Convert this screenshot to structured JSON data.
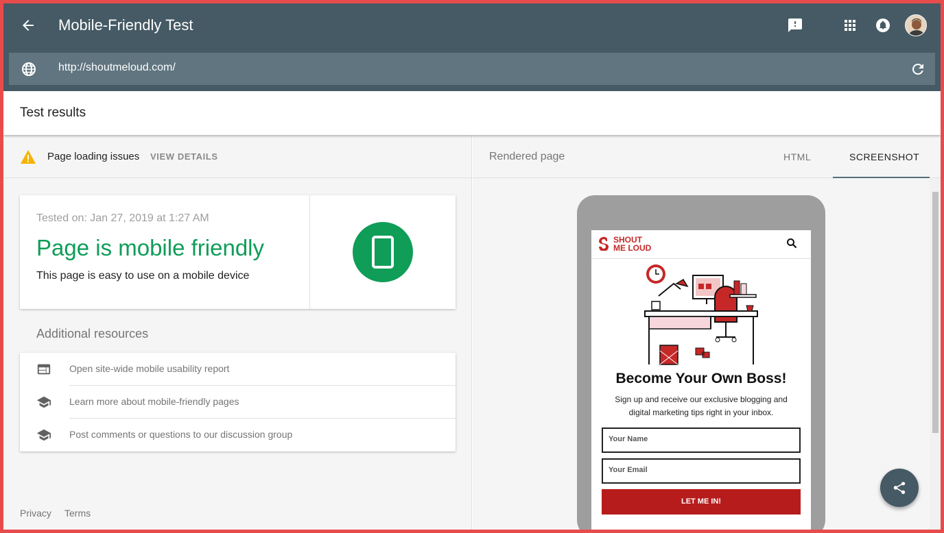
{
  "header": {
    "title": "Mobile-Friendly Test"
  },
  "url_bar": {
    "url": "http://shoutmeloud.com/"
  },
  "results": {
    "heading": "Test results"
  },
  "issues": {
    "text": "Page loading issues",
    "action": "VIEW DETAILS"
  },
  "verdict": {
    "tested_on": "Tested on: Jan 27, 2019 at 1:27 AM",
    "headline": "Page is mobile friendly",
    "subtext": "This page is easy to use on a mobile device"
  },
  "additional": {
    "heading": "Additional resources",
    "items": [
      {
        "label": "Open site-wide mobile usability report",
        "icon": "web-icon"
      },
      {
        "label": "Learn more about mobile-friendly pages",
        "icon": "school-icon"
      },
      {
        "label": "Post comments or questions to our discussion group",
        "icon": "school-icon"
      }
    ]
  },
  "footer": {
    "privacy": "Privacy",
    "terms": "Terms"
  },
  "rendered": {
    "label": "Rendered page",
    "tabs": [
      "HTML",
      "SCREENSHOT"
    ],
    "active_tab": "SCREENSHOT"
  },
  "preview": {
    "brand_line1": "SHOUT",
    "brand_line2": "ME LOUD",
    "headline": "Become Your Own Boss!",
    "subtext": "Sign up and receive our exclusive blogging and digital marketing tips right in your inbox.",
    "name_placeholder": "Your Name",
    "email_placeholder": "Your Email",
    "button": "LET ME IN!"
  },
  "colors": {
    "app_bar": "#455a64",
    "url_bar": "#607580",
    "success": "#0f9d58",
    "warning": "#f4b400",
    "frame": "#e84b4b",
    "brand_red": "#c62828"
  }
}
